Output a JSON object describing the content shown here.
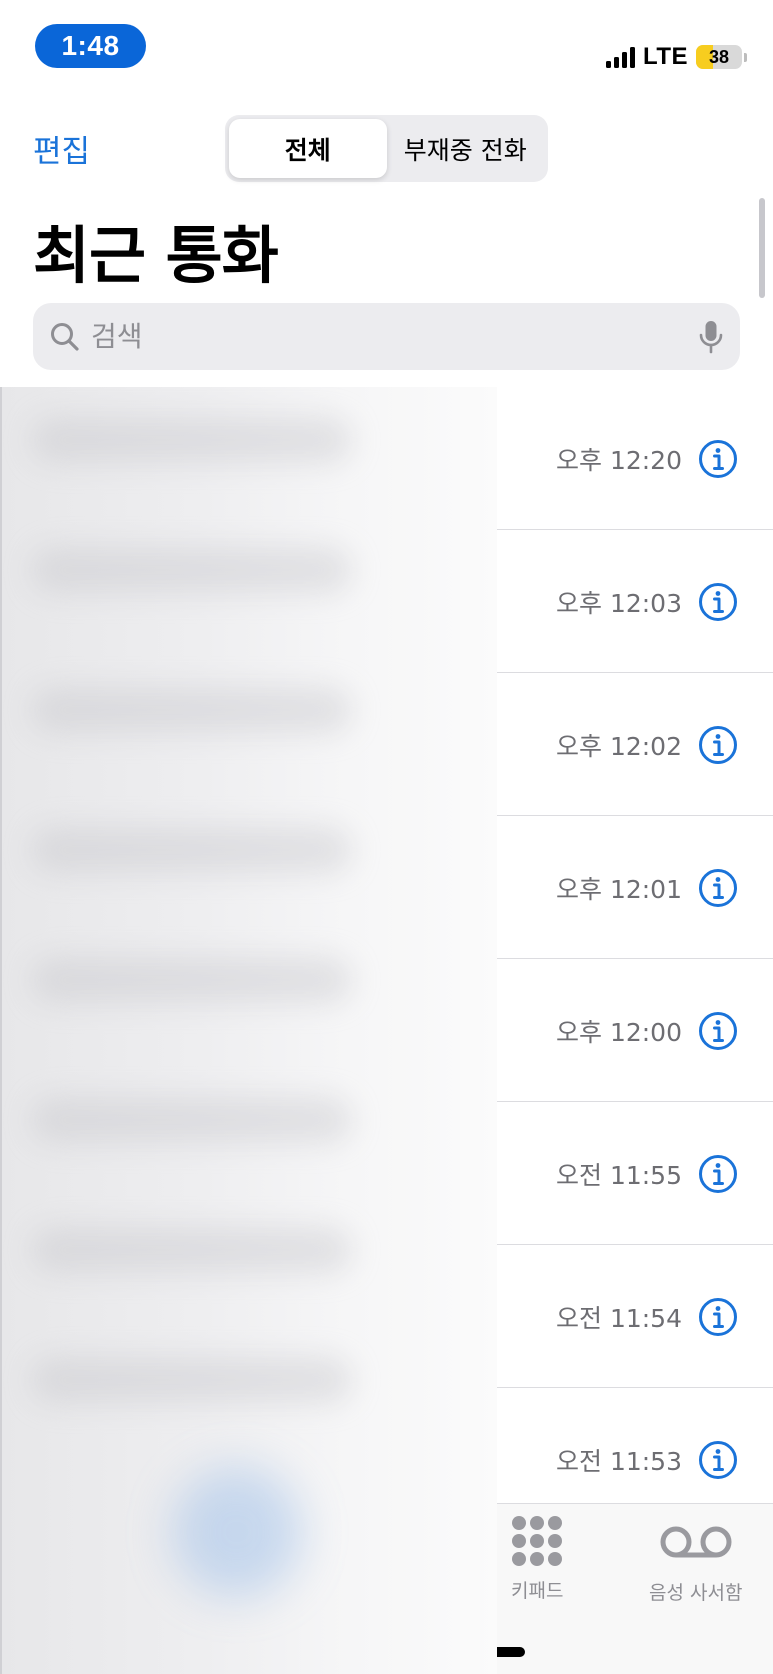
{
  "status_bar": {
    "time": "1:48",
    "network": "LTE",
    "battery": "38",
    "battery_fraction": 0.38
  },
  "header": {
    "edit_label": "편집",
    "segments": [
      {
        "label": "전체",
        "active": true
      },
      {
        "label": "부재중 전화",
        "active": false
      }
    ],
    "title": "최근 통화"
  },
  "search": {
    "placeholder": "검색"
  },
  "calls": [
    {
      "time": "오후 12:20"
    },
    {
      "time": "오후 12:03"
    },
    {
      "time": "오후 12:02"
    },
    {
      "time": "오후 12:01"
    },
    {
      "time": "오후 12:00"
    },
    {
      "time": "오전 11:55"
    },
    {
      "time": "오전 11:54"
    },
    {
      "time": "오전 11:53"
    }
  ],
  "tabbar": {
    "keypad_label": "키패드",
    "voicemail_label": "음성 사서함"
  },
  "colors": {
    "accent": "#1a73d9",
    "time_pill": "#0a66d8",
    "battery_fill": "#f7cd1f"
  },
  "icons": {
    "search": "magnifier-icon",
    "mic": "microphone-icon",
    "info": "info-circle-icon",
    "keypad": "keypad-grid-icon",
    "voicemail": "voicemail-icon"
  }
}
